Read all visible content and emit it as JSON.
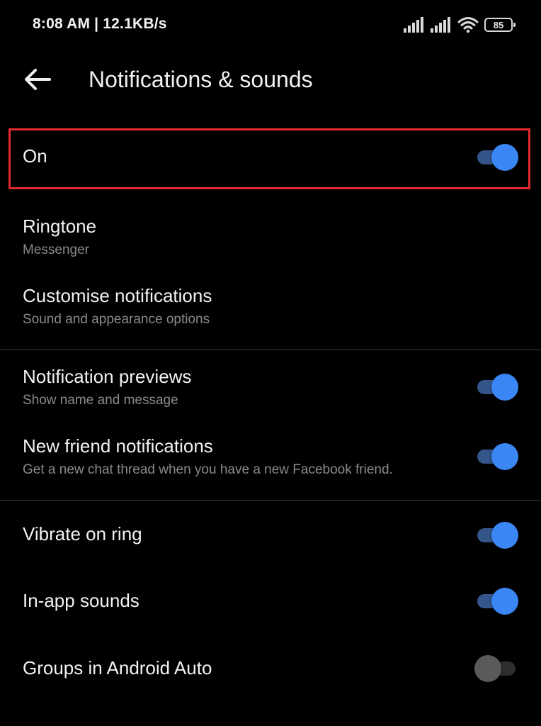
{
  "status_bar": {
    "time": "8:08 AM | 12.1KB/s",
    "battery": "85",
    "icons": [
      "signal-icon",
      "signal-icon",
      "wifi-icon",
      "battery-icon"
    ]
  },
  "header": {
    "back_icon": "arrow-left-icon",
    "title": "Notifications & sounds"
  },
  "settings": {
    "on": {
      "title": "On",
      "enabled": true
    },
    "ringtone": {
      "title": "Ringtone",
      "subtitle": "Messenger"
    },
    "customise": {
      "title": "Customise notifications",
      "subtitle": "Sound and appearance options"
    },
    "previews": {
      "title": "Notification previews",
      "subtitle": "Show name and message",
      "enabled": true
    },
    "new_friend": {
      "title": "New friend notifications",
      "subtitle": "Get a new chat thread when you have a new Facebook friend.",
      "enabled": true
    },
    "vibrate": {
      "title": "Vibrate on ring",
      "enabled": true
    },
    "in_app_sounds": {
      "title": "In-app sounds",
      "enabled": true
    },
    "android_auto": {
      "title": "Groups in Android Auto",
      "enabled": false
    }
  },
  "colors": {
    "background": "#000000",
    "accent": "#3b86f5",
    "highlight": "#e02a2f",
    "subtitle": "#8a8a8a"
  }
}
